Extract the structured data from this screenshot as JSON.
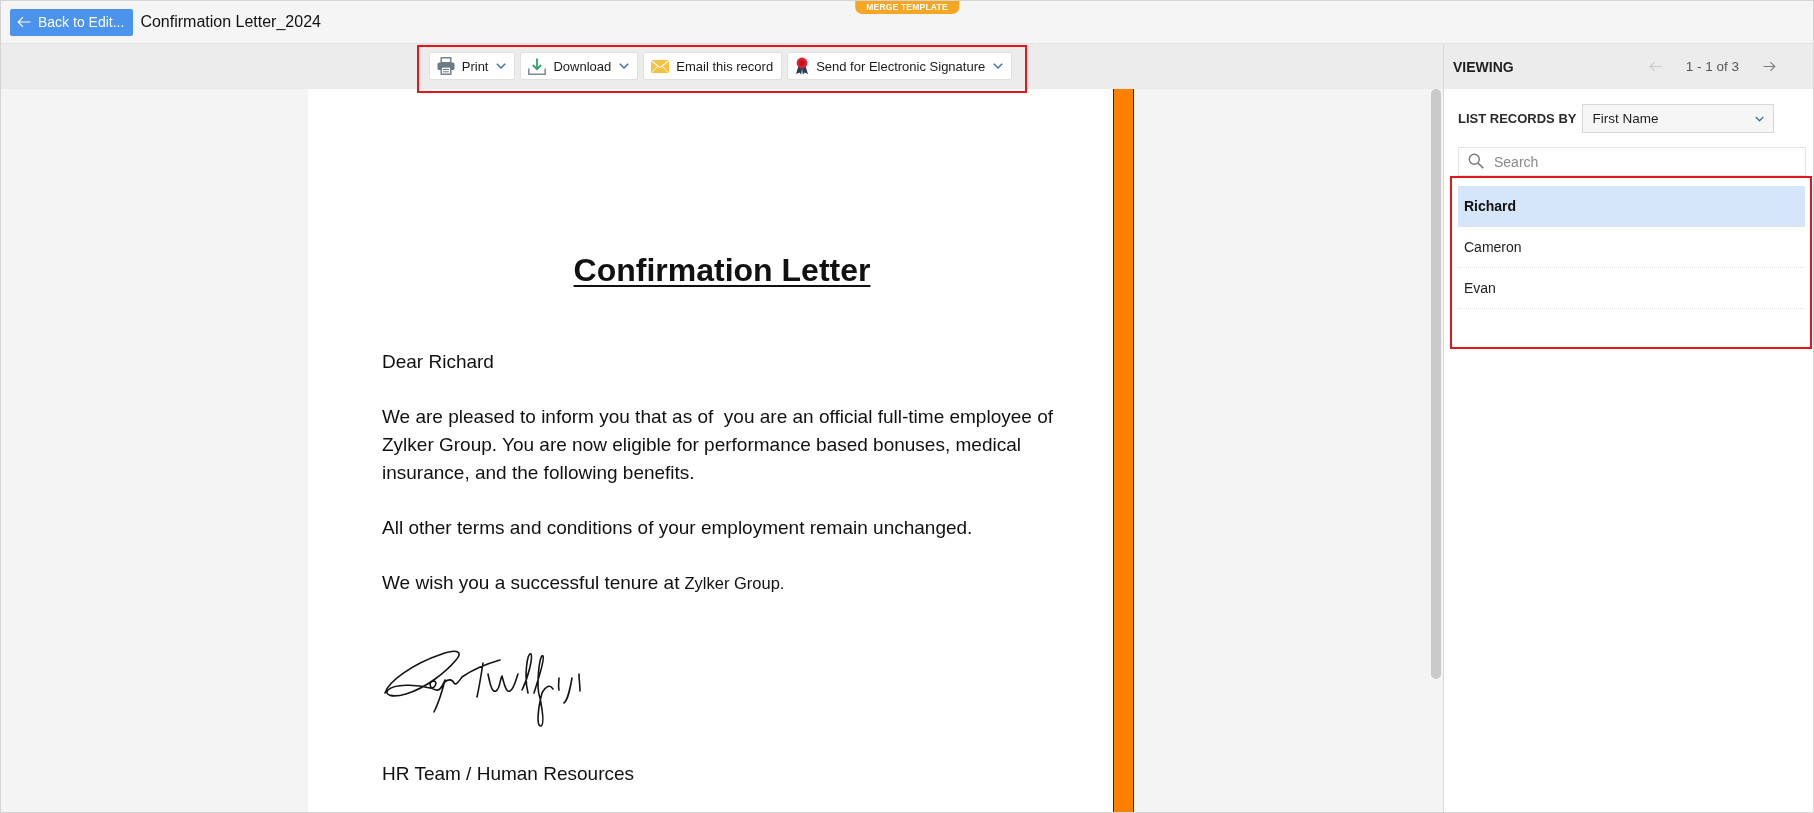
{
  "top_bar": {
    "back_button": "Back to Edit...",
    "title": "Confirmation Letter_2024",
    "badge": "MERGE TEMPLATE"
  },
  "toolbar": {
    "highlighted": true,
    "buttons": [
      {
        "kind": "print",
        "label": "Print",
        "dropdown": true
      },
      {
        "kind": "download",
        "label": "Download",
        "dropdown": true
      },
      {
        "kind": "email",
        "label": "Email this record",
        "dropdown": false
      },
      {
        "kind": "signature",
        "label": "Send for Electronic Signature",
        "dropdown": true
      }
    ]
  },
  "document": {
    "title": "Confirmation Letter",
    "greeting": "Dear Richard",
    "paragraphs": [
      {
        "text": "We are pleased to inform you that as of  you are an official full-time employee of Zylker Group. You are now eligible for performance based bonuses, medical insurance, and the following benefits."
      },
      {
        "text": "All other terms and conditions of your employment remain unchanged."
      },
      {
        "text": "We wish you a successful tenure at",
        "merge_value": "Zylker Group."
      }
    ],
    "sign_off": "HR Team / Human Resources"
  },
  "viewer_panel": {
    "title": "VIEWING",
    "pager": {
      "text": "1 - 1 of 3",
      "prev_disabled": true,
      "next_disabled": false
    },
    "list_by": {
      "label": "LIST RECORDS BY",
      "value": "First Name"
    },
    "search": {
      "placeholder": "Search"
    },
    "records": {
      "highlighted": true,
      "items": [
        {
          "name": "Richard",
          "selected": true
        },
        {
          "name": "Cameron",
          "selected": false
        },
        {
          "name": "Evan",
          "selected": false
        }
      ]
    }
  }
}
